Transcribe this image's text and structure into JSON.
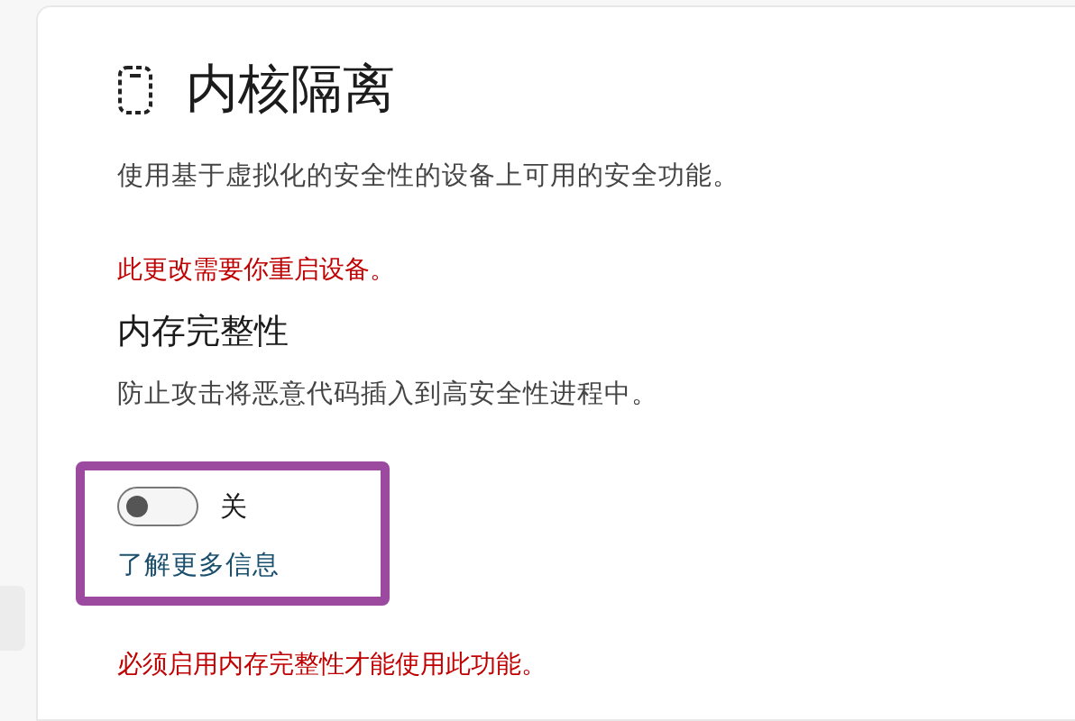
{
  "title": "内核隔离",
  "description": "使用基于虚拟化的安全性的设备上可用的安全功能。",
  "restart_notice": "此更改需要你重启设备。",
  "section": {
    "heading": "内存完整性",
    "description": "防止攻击将恶意代码插入到高安全性进程中。",
    "toggle": {
      "on": false,
      "label": "关"
    },
    "link": "了解更多信息"
  },
  "warning": "必须启用内存完整性才能使用此功能。"
}
